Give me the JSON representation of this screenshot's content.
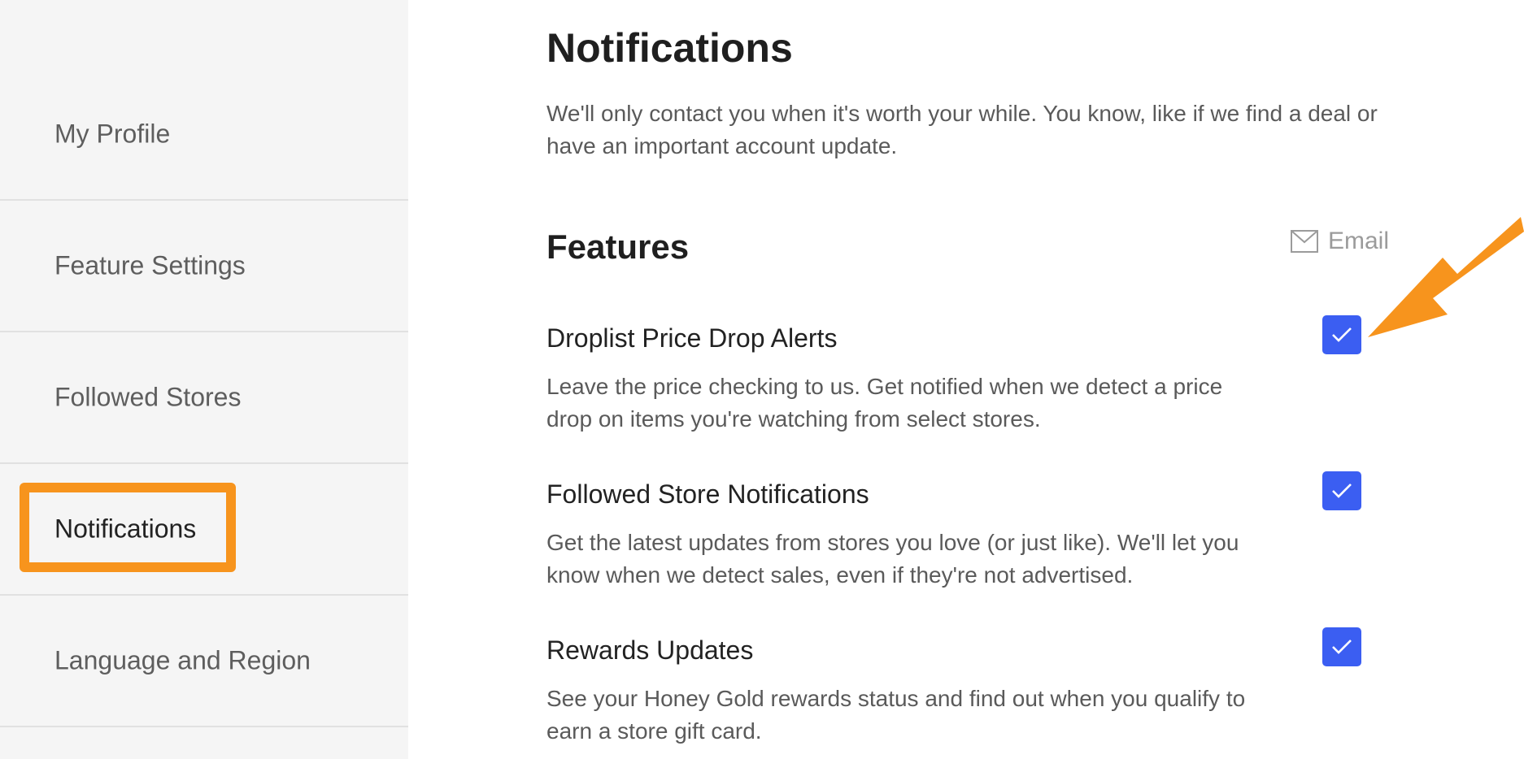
{
  "sidebar": {
    "items": [
      {
        "label": "My Profile"
      },
      {
        "label": "Feature Settings"
      },
      {
        "label": "Followed Stores"
      },
      {
        "label": "Notifications",
        "active": true
      },
      {
        "label": "Language and Region"
      }
    ]
  },
  "main": {
    "title": "Notifications",
    "intro": "We'll only contact you when it's worth your while. You know, like if we find a deal or have an important account update.",
    "section": {
      "title": "Features",
      "column_label": "Email",
      "column_icon": "envelope-icon",
      "items": [
        {
          "name": "Droplist Price Drop Alerts",
          "description": "Leave the price checking to us. Get notified when we detect a price drop on items you're watching from select stores.",
          "email_checked": true
        },
        {
          "name": "Followed Store Notifications",
          "description": "Get the latest updates from stores you love (or just like). We'll let you know when we detect sales, even if they're not advertised.",
          "email_checked": true
        },
        {
          "name": "Rewards Updates",
          "description": "See your Honey Gold rewards status and find out when you qualify to earn a store gift card.",
          "email_checked": true
        }
      ]
    }
  },
  "colors": {
    "accent": "#3b5ef2",
    "highlight": "#f7941d",
    "sidebar_bg": "#f5f5f5"
  },
  "annotations": {
    "highlight_icon": "highlight-box",
    "arrow_icon": "arrow-icon"
  }
}
